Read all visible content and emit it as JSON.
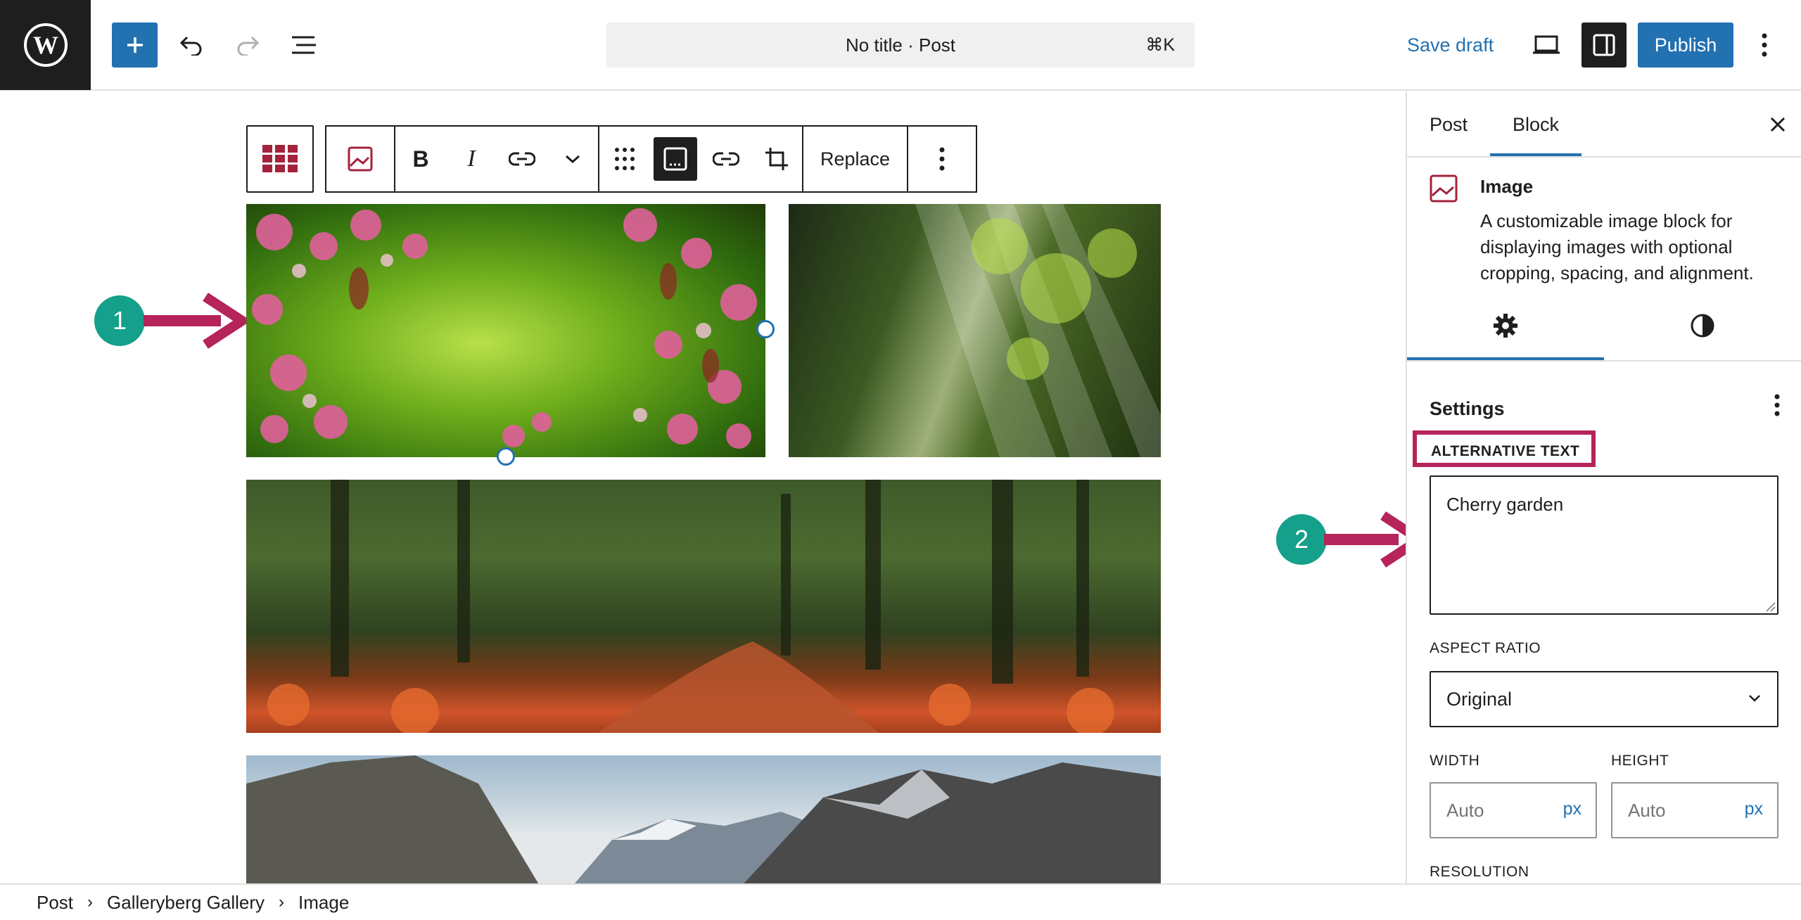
{
  "topbar": {
    "logo": "wordpress-logo",
    "document_title": "No title · Post",
    "shortcut": "⌘K",
    "save_draft": "Save draft",
    "publish": "Publish"
  },
  "block_toolbar": {
    "replace": "Replace"
  },
  "callouts": {
    "one": "1",
    "two": "2"
  },
  "colors": {
    "accent": "#2271b1",
    "highlight": "#b5245a",
    "callout": "#14a08a"
  },
  "sidebar": {
    "tabs": [
      "Post",
      "Block"
    ],
    "active_tab": "Block",
    "block_name": "Image",
    "block_description": "A customizable image block for displaying images with optional cropping, spacing, and alignment.",
    "settings_title": "Settings",
    "alt_text_label": "ALTERNATIVE TEXT",
    "alt_text_value": "Cherry garden",
    "aspect_ratio_label": "ASPECT RATIO",
    "aspect_ratio_value": "Original",
    "width_label": "WIDTH",
    "height_label": "HEIGHT",
    "width_placeholder": "Auto",
    "height_placeholder": "Auto",
    "unit": "px",
    "resolution_label": "RESOLUTION"
  },
  "breadcrumb": [
    "Post",
    "Galleryberg Gallery",
    "Image"
  ]
}
